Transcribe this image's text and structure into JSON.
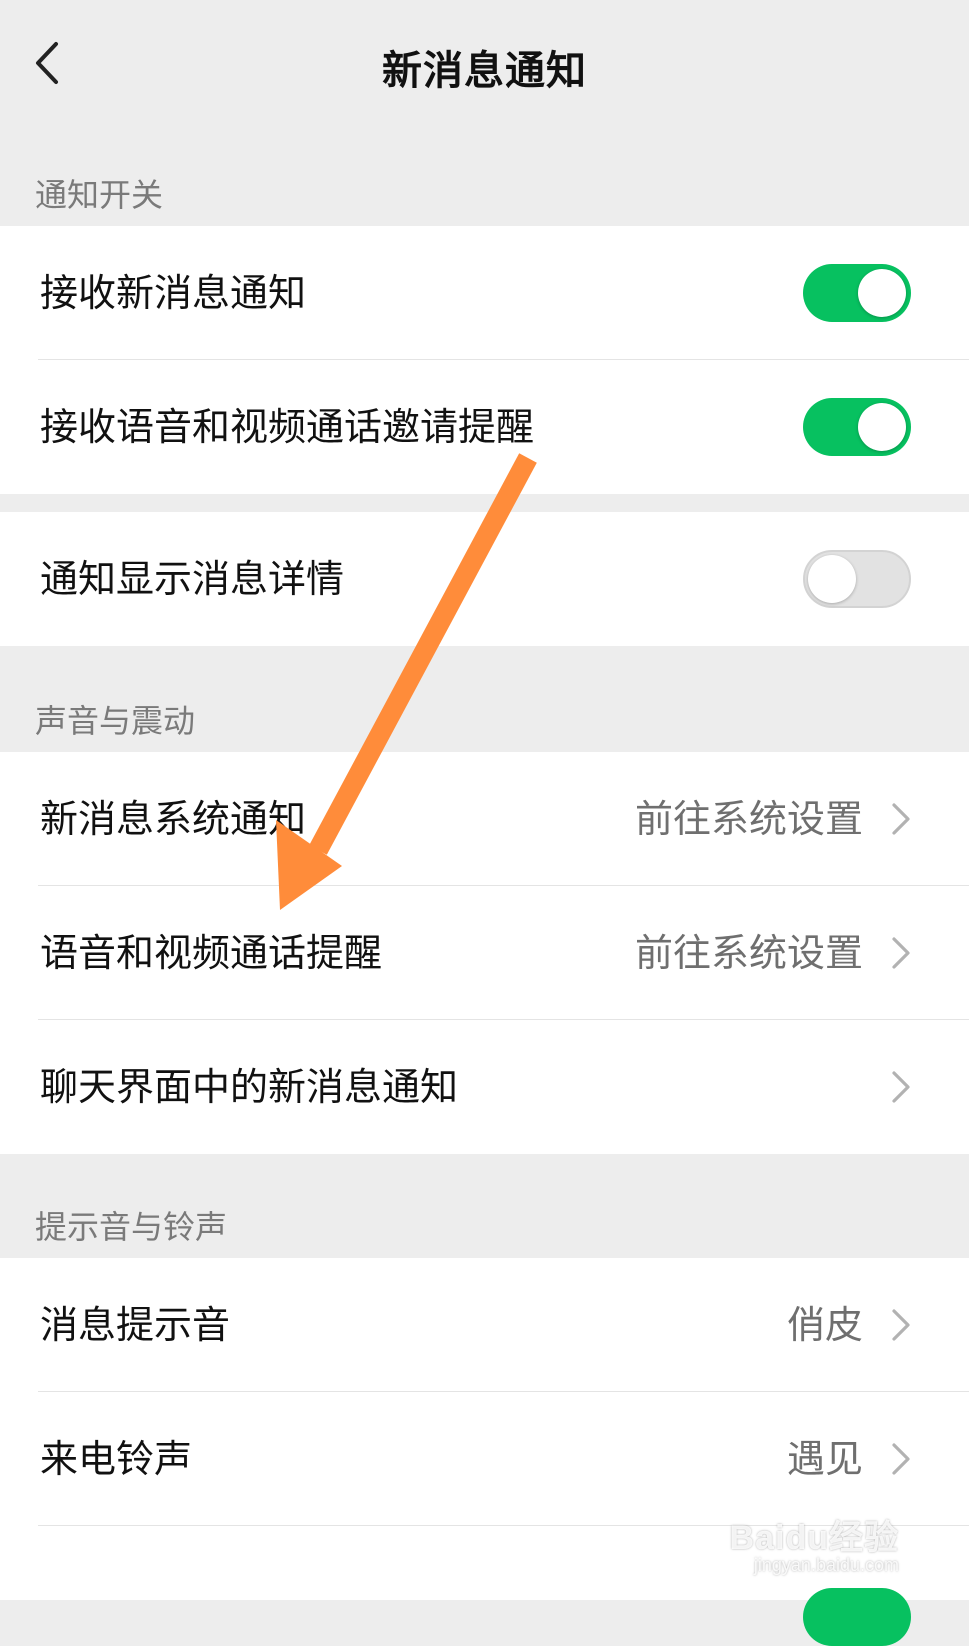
{
  "header": {
    "title": "新消息通知"
  },
  "sections": {
    "notify_switch": {
      "title": "通知开关",
      "items": [
        {
          "label": "接收新消息通知",
          "toggle": "on"
        },
        {
          "label": "接收语音和视频通话邀请提醒",
          "toggle": "on"
        }
      ],
      "extra": {
        "label": "通知显示消息详情",
        "toggle": "off"
      }
    },
    "sound_vibration": {
      "title": "声音与震动",
      "items": [
        {
          "label": "新消息系统通知",
          "value": "前往系统设置"
        },
        {
          "label": "语音和视频通话提醒",
          "value": "前往系统设置"
        },
        {
          "label": "聊天界面中的新消息通知",
          "value": ""
        }
      ]
    },
    "tones": {
      "title": "提示音与铃声",
      "items": [
        {
          "label": "消息提示音",
          "value": "俏皮"
        },
        {
          "label": "来电铃声",
          "value": "遇见"
        }
      ]
    }
  },
  "icons": {
    "back": "chevron-left-icon",
    "row_arrow": "chevron-right-icon",
    "annotation": "orange-arrow"
  },
  "colors": {
    "toggle_on": "#07c160",
    "annotation_arrow": "#ff8c3a",
    "background": "#ededed"
  },
  "watermark": {
    "main": "Baidu经验",
    "sub": "jingyan.baidu.com"
  }
}
